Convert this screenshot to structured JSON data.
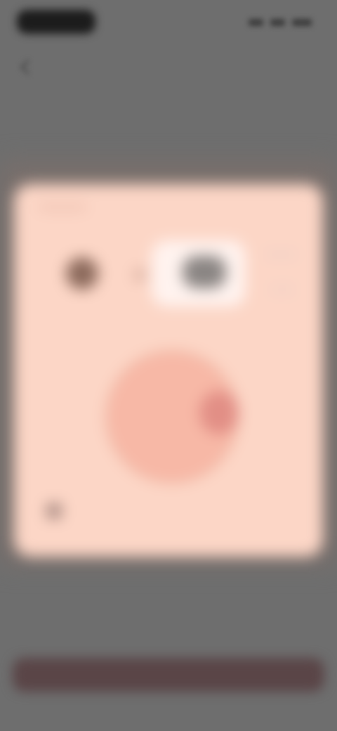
{
  "status_bar": {
    "time": "",
    "icons": [
      "signal-icon",
      "wifi-icon",
      "battery-icon"
    ]
  },
  "navigation": {
    "back_icon": "chevron-left-icon"
  },
  "card": {
    "label": "",
    "modes": [
      {
        "icon": "mode-icon-left",
        "selected": false
      },
      {
        "icon": "mode-icon-center",
        "selected": true
      },
      {
        "icon": "mode-icon-right",
        "selected": false
      }
    ],
    "dial": {
      "value": ""
    },
    "footer_icon": "small-icon"
  },
  "cta": {
    "label": ""
  },
  "colors": {
    "background": "#6e6e6e",
    "card": "#fcd6c6",
    "selected_mode": "#fff3ef",
    "dial": "#f7b8a6",
    "dial_knob": "#e28f86",
    "cta": "#5a4547"
  }
}
